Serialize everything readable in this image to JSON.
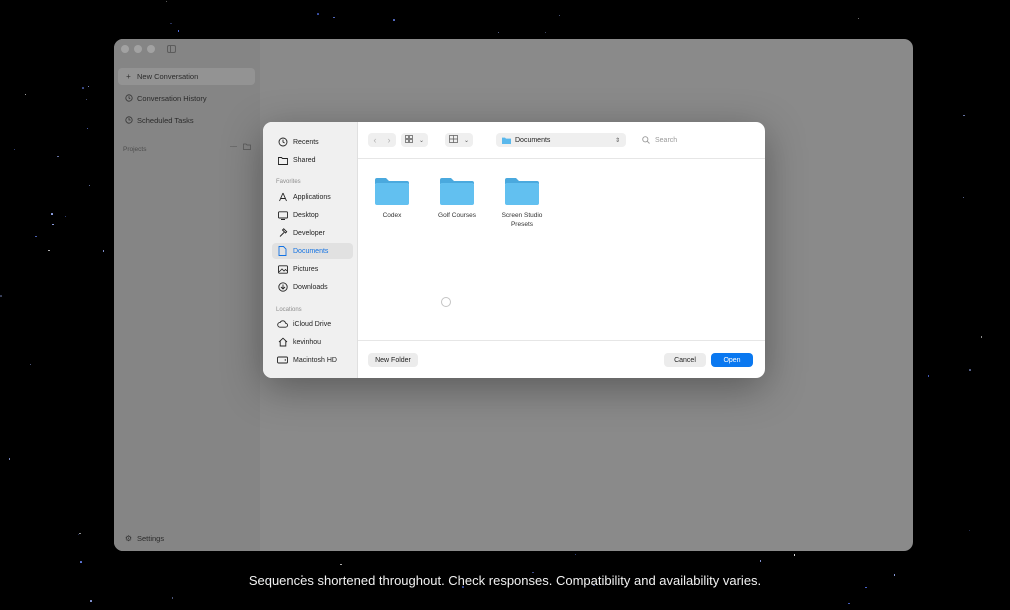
{
  "app": {
    "nav": [
      {
        "label": "New Conversation",
        "icon": "plus-icon",
        "active": true
      },
      {
        "label": "Conversation History",
        "icon": "history-icon",
        "active": false
      },
      {
        "label": "Scheduled Tasks",
        "icon": "clock-icon",
        "active": false
      }
    ],
    "projects_label": "Projects",
    "settings_label": "Settings"
  },
  "dialog": {
    "sidebar": {
      "recents": "Recents",
      "shared": "Shared",
      "favorites_label": "Favorites",
      "favorites": [
        {
          "label": "Applications",
          "icon": "applications-icon"
        },
        {
          "label": "Desktop",
          "icon": "desktop-icon"
        },
        {
          "label": "Developer",
          "icon": "hammer-icon"
        },
        {
          "label": "Documents",
          "icon": "document-icon",
          "active": true
        },
        {
          "label": "Pictures",
          "icon": "photo-icon"
        },
        {
          "label": "Downloads",
          "icon": "download-icon"
        }
      ],
      "locations_label": "Locations",
      "locations": [
        {
          "label": "iCloud Drive",
          "icon": "cloud-icon"
        },
        {
          "label": "kevinhou",
          "icon": "home-icon"
        },
        {
          "label": "Macintosh HD",
          "icon": "disk-icon"
        }
      ]
    },
    "toolbar": {
      "path": "Documents",
      "search_placeholder": "Search"
    },
    "folders": [
      {
        "label": "Codex"
      },
      {
        "label": "Golf Courses"
      },
      {
        "label": "Screen Studio Presets"
      }
    ],
    "footer": {
      "new_folder": "New Folder",
      "cancel": "Cancel",
      "open": "Open"
    }
  },
  "caption": "Sequences shortened throughout. Check responses. Compatibility and availability varies.",
  "colors": {
    "accent": "#0a78f0",
    "folder": "#5ab8ec",
    "background": "#000000"
  }
}
